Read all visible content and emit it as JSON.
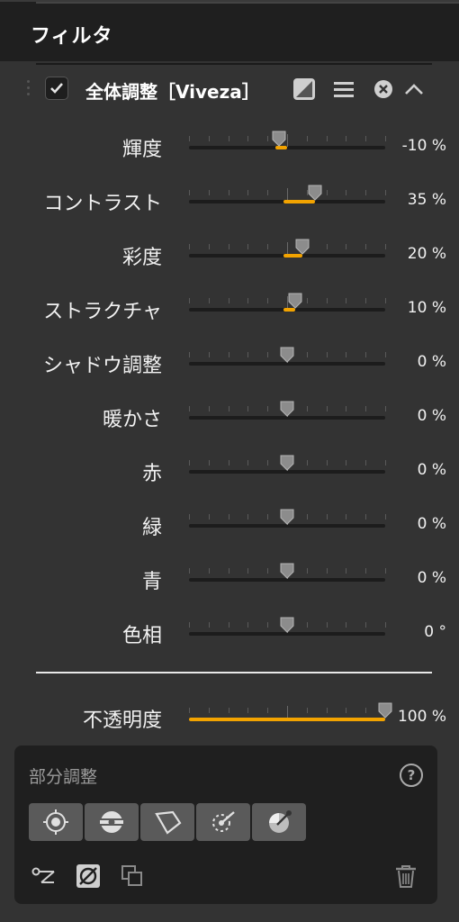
{
  "panel": {
    "title": "フィルタ"
  },
  "filter": {
    "name": "全体調整［Viveza］",
    "enabled": true
  },
  "rows": [
    {
      "label": "輝度",
      "value_text": "-10 %",
      "value": -10
    },
    {
      "label": "コントラスト",
      "value_text": "35 %",
      "value": 35
    },
    {
      "label": "彩度",
      "value_text": "20 %",
      "value": 20
    },
    {
      "label": "ストラクチャ",
      "value_text": "10 %",
      "value": 10
    },
    {
      "label": "シャドウ調整",
      "value_text": "0 %",
      "value": 0
    },
    {
      "label": "暖かさ",
      "value_text": "0 %",
      "value": 0
    },
    {
      "label": "赤",
      "value_text": "0 %",
      "value": 0
    },
    {
      "label": "緑",
      "value_text": "0 %",
      "value": 0
    },
    {
      "label": "青",
      "value_text": "0 %",
      "value": 0
    },
    {
      "label": "色相",
      "value_text": "0 °",
      "value": 0
    }
  ],
  "opacity": {
    "label": "不透明度",
    "value_text": "100 %",
    "value": 100
  },
  "local": {
    "title": "部分調整",
    "help": "?",
    "tools": [
      "control-point-tool",
      "circle-mask-tool",
      "polygon-mask-tool",
      "brush-tool",
      "color-picker-tool"
    ]
  },
  "colors": {
    "accent": "#f2a300",
    "background": "#333333",
    "header": "#1f1f1f"
  }
}
